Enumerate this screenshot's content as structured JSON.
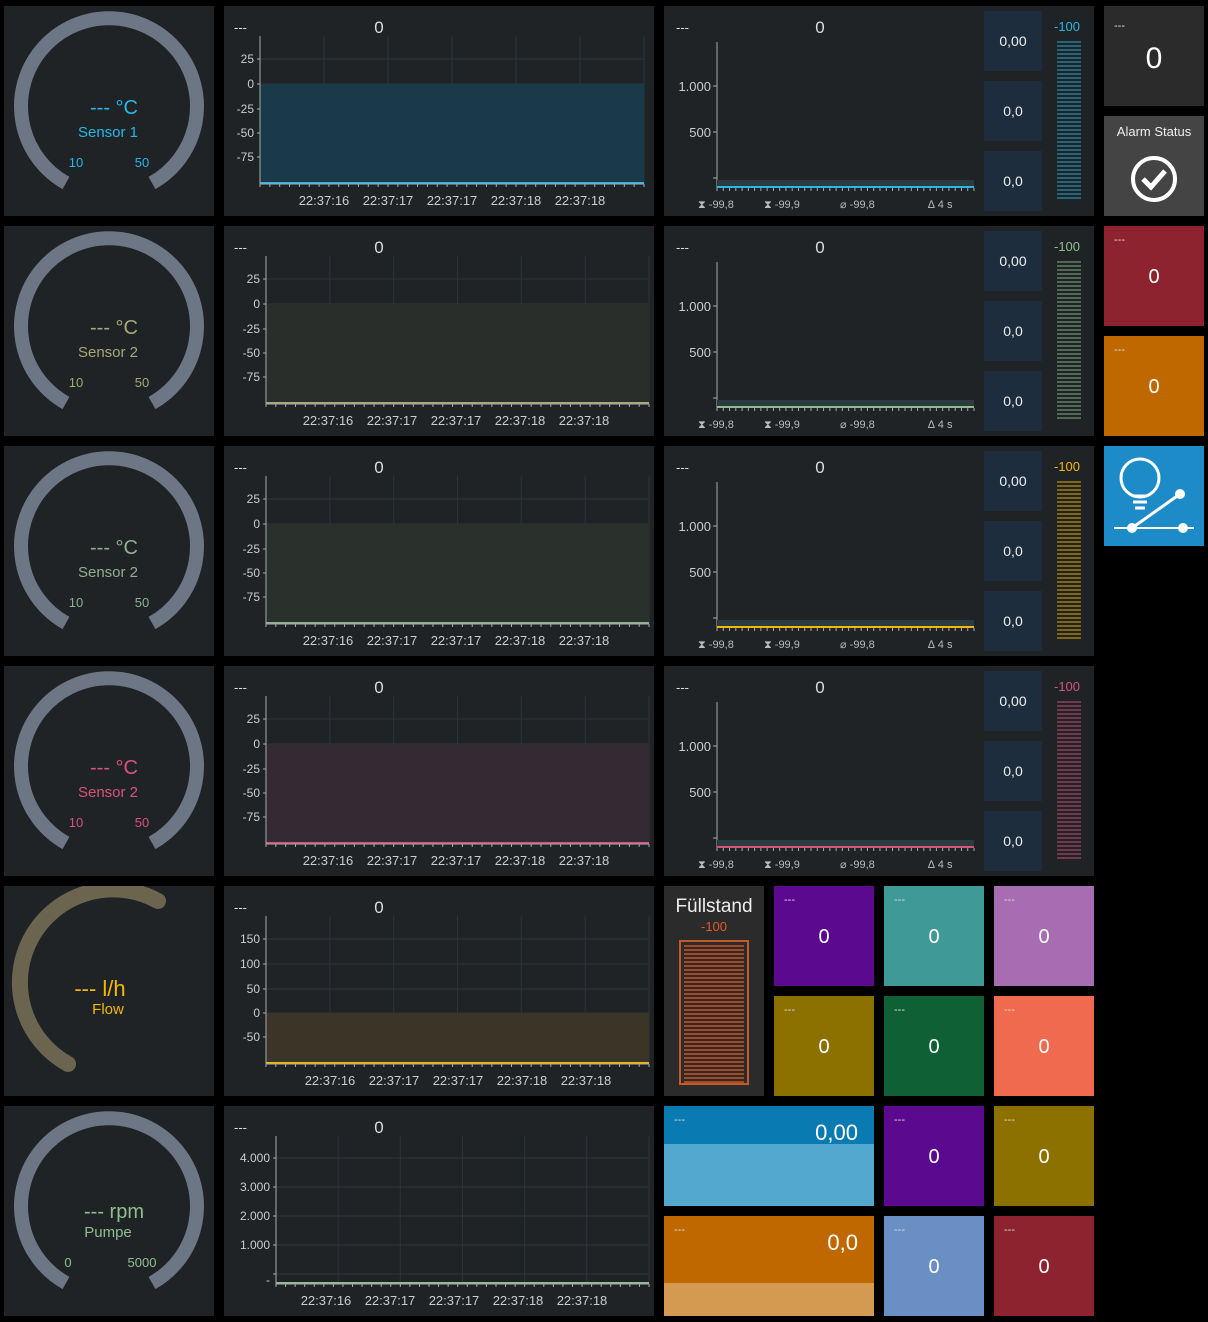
{
  "placeholder": "---",
  "gauges": [
    {
      "unit": "°C",
      "label": "Sensor 1",
      "min": "10",
      "max": "50",
      "color": "#29b6e8"
    },
    {
      "unit": "°C",
      "label": "Sensor 2",
      "min": "10",
      "max": "50",
      "color": "#a8a878"
    },
    {
      "unit": "°C",
      "label": "Sensor 2",
      "min": "10",
      "max": "50",
      "color": "#8fb08f"
    },
    {
      "unit": "°C",
      "label": "Sensor 2",
      "min": "10",
      "max": "50",
      "color": "#d9527a"
    },
    {
      "unit": "l/h",
      "label": "Flow",
      "min": "",
      "max": "",
      "color": "#f5b800"
    },
    {
      "unit": "rpm",
      "label": "Pumpe",
      "min": "0",
      "max": "5000",
      "color": "#8fbf8f"
    }
  ],
  "line_charts": [
    {
      "value": "0",
      "ticks": [
        "25",
        "0",
        "-25",
        "-50",
        "-75"
      ],
      "color": "#29b6e8",
      "fill": "#1a3a4a",
      "times": [
        "22:37:16",
        "22:37:17",
        "22:37:17",
        "22:37:18",
        "22:37:18"
      ]
    },
    {
      "value": "0",
      "ticks": [
        "25",
        "0",
        "-25",
        "-50",
        "-75"
      ],
      "color": "#a8a878",
      "fill": "#2a2e2a",
      "times": [
        "22:37:16",
        "22:37:17",
        "22:37:17",
        "22:37:18",
        "22:37:18"
      ]
    },
    {
      "value": "0",
      "ticks": [
        "25",
        "0",
        "-25",
        "-50",
        "-75"
      ],
      "color": "#8fb08f",
      "fill": "#2a302c",
      "times": [
        "22:37:16",
        "22:37:17",
        "22:37:17",
        "22:37:18",
        "22:37:18"
      ]
    },
    {
      "value": "0",
      "ticks": [
        "25",
        "0",
        "-25",
        "-50",
        "-75"
      ],
      "color": "#d9527a",
      "fill": "#332a33",
      "times": [
        "22:37:16",
        "22:37:17",
        "22:37:17",
        "22:37:18",
        "22:37:18"
      ]
    },
    {
      "value": "0",
      "ticks": [
        "150",
        "100",
        "50",
        "0",
        "-50"
      ],
      "color": "#f5b800",
      "fill": "#3a3526",
      "times": [
        "22:37:16",
        "22:37:17",
        "22:37:17",
        "22:37:18",
        "22:37:18"
      ]
    },
    {
      "value": "0",
      "ticks": [
        "4.000",
        "3.000",
        "2.000",
        "1.000",
        ""
      ],
      "color": "#8fbf8f",
      "fill": "#1f2326",
      "times": [
        "22:37:16",
        "22:37:17",
        "22:37:17",
        "22:37:18",
        "22:37:18"
      ]
    }
  ],
  "stat_charts": [
    {
      "value": "0",
      "ticks": [
        "1.000",
        "500"
      ],
      "footer": [
        "-99,8",
        "-99,9",
        "-99,8",
        "4 s"
      ],
      "boxes": [
        "0,00",
        "0,0",
        "0,0"
      ],
      "bar_value": "-100",
      "color": "#29b6e8"
    },
    {
      "value": "0",
      "ticks": [
        "1.000",
        "500"
      ],
      "footer": [
        "-99,8",
        "-99,9",
        "-99,8",
        "4 s"
      ],
      "boxes": [
        "0,00",
        "0,0",
        "0,0"
      ],
      "bar_value": "-100",
      "color": "#8fbf8f"
    },
    {
      "value": "0",
      "ticks": [
        "1.000",
        "500"
      ],
      "footer": [
        "-99,8",
        "-99,9",
        "-99,8",
        "4 s"
      ],
      "boxes": [
        "0,00",
        "0,0",
        "0,0"
      ],
      "bar_value": "-100",
      "color": "#f5b800"
    },
    {
      "value": "0",
      "ticks": [
        "1.000",
        "500"
      ],
      "footer": [
        "-99,8",
        "-99,9",
        "-99,8",
        "4 s"
      ],
      "boxes": [
        "0,00",
        "0,0",
        "0,0"
      ],
      "bar_value": "-100",
      "color": "#d9527a"
    }
  ],
  "right_column": {
    "top_value": "0",
    "alarm_label": "Alarm Status",
    "red_value": "0",
    "orange_value": "0"
  },
  "fuellstand": {
    "title": "Füllstand",
    "value": "-100"
  },
  "color_tiles": [
    {
      "value": "0",
      "color": "#5b0a8f"
    },
    {
      "value": "0",
      "color": "#3f9996"
    },
    {
      "value": "0",
      "color": "#a86cb3"
    },
    {
      "value": "0",
      "color": "#8c7000"
    },
    {
      "value": "0",
      "color": "#0f6035"
    },
    {
      "value": "0",
      "color": "#ef6a4e"
    },
    {
      "value": "0",
      "color": "#5b0a8f"
    },
    {
      "value": "0",
      "color": "#8c7000"
    },
    {
      "value": "0",
      "color": "#6a8fc4"
    },
    {
      "value": "0",
      "color": "#8e2330"
    }
  ],
  "fill_tiles": [
    {
      "value": "0,00",
      "top": "#0a7ab3",
      "bottom": "#52a8cf"
    },
    {
      "value": "0,0",
      "top": "#c06800",
      "bottom": "#d49a52"
    }
  ]
}
